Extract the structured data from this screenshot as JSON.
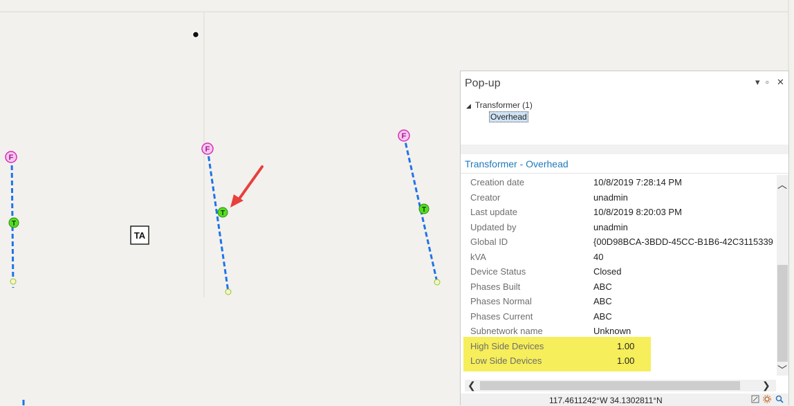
{
  "map": {
    "label_block": "TA",
    "feeder_symbol": "F",
    "transformer_symbol": "T"
  },
  "popup": {
    "title": "Pop-up",
    "window_buttons": {
      "menu": "▾",
      "maximize": "▫",
      "close": "✕"
    },
    "tree": {
      "expander": "◢",
      "layer_label": "Transformer  (1)",
      "feature_label": "Overhead"
    },
    "feature_title": "Transformer - Overhead",
    "attributes": [
      {
        "label": "Creation date",
        "value": "10/8/2019 7:28:14 PM"
      },
      {
        "label": "Creator",
        "value": "unadmin"
      },
      {
        "label": "Last update",
        "value": "10/8/2019 8:20:03 PM"
      },
      {
        "label": "Updated by",
        "value": "unadmin"
      },
      {
        "label": "Global ID",
        "value": "{00D98BCA-3BDD-45CC-B1B6-42C3115339"
      },
      {
        "label": "kVA",
        "value": "40"
      },
      {
        "label": "Device Status",
        "value": "Closed"
      },
      {
        "label": "Phases Built",
        "value": "ABC"
      },
      {
        "label": "Phases Normal",
        "value": "ABC"
      },
      {
        "label": "Phases Current",
        "value": "ABC"
      },
      {
        "label": "Subnetwork name",
        "value": "Unknown"
      },
      {
        "label": "High Side Devices",
        "value": "1.00"
      },
      {
        "label": "Low Side Devices",
        "value": "1.00"
      }
    ],
    "scroll": {
      "up": "︿",
      "down": "﹀",
      "left": "❮",
      "right": "❯"
    },
    "status": {
      "coordinates": "117.4611242°W 34.1302811°N",
      "icons": [
        "snap-icon",
        "settings-icon",
        "zoom-icon"
      ]
    }
  },
  "colors": {
    "map_background": "#f2f1ed",
    "line": "#1e73e8",
    "feeder_fill": "#f9c6ef",
    "feeder_stroke": "#d42fb7",
    "transformer_fill": "#55dd22",
    "arrow": "#e8403a",
    "highlight": "#f6ee5a",
    "title_blue": "#1f7ab9"
  }
}
